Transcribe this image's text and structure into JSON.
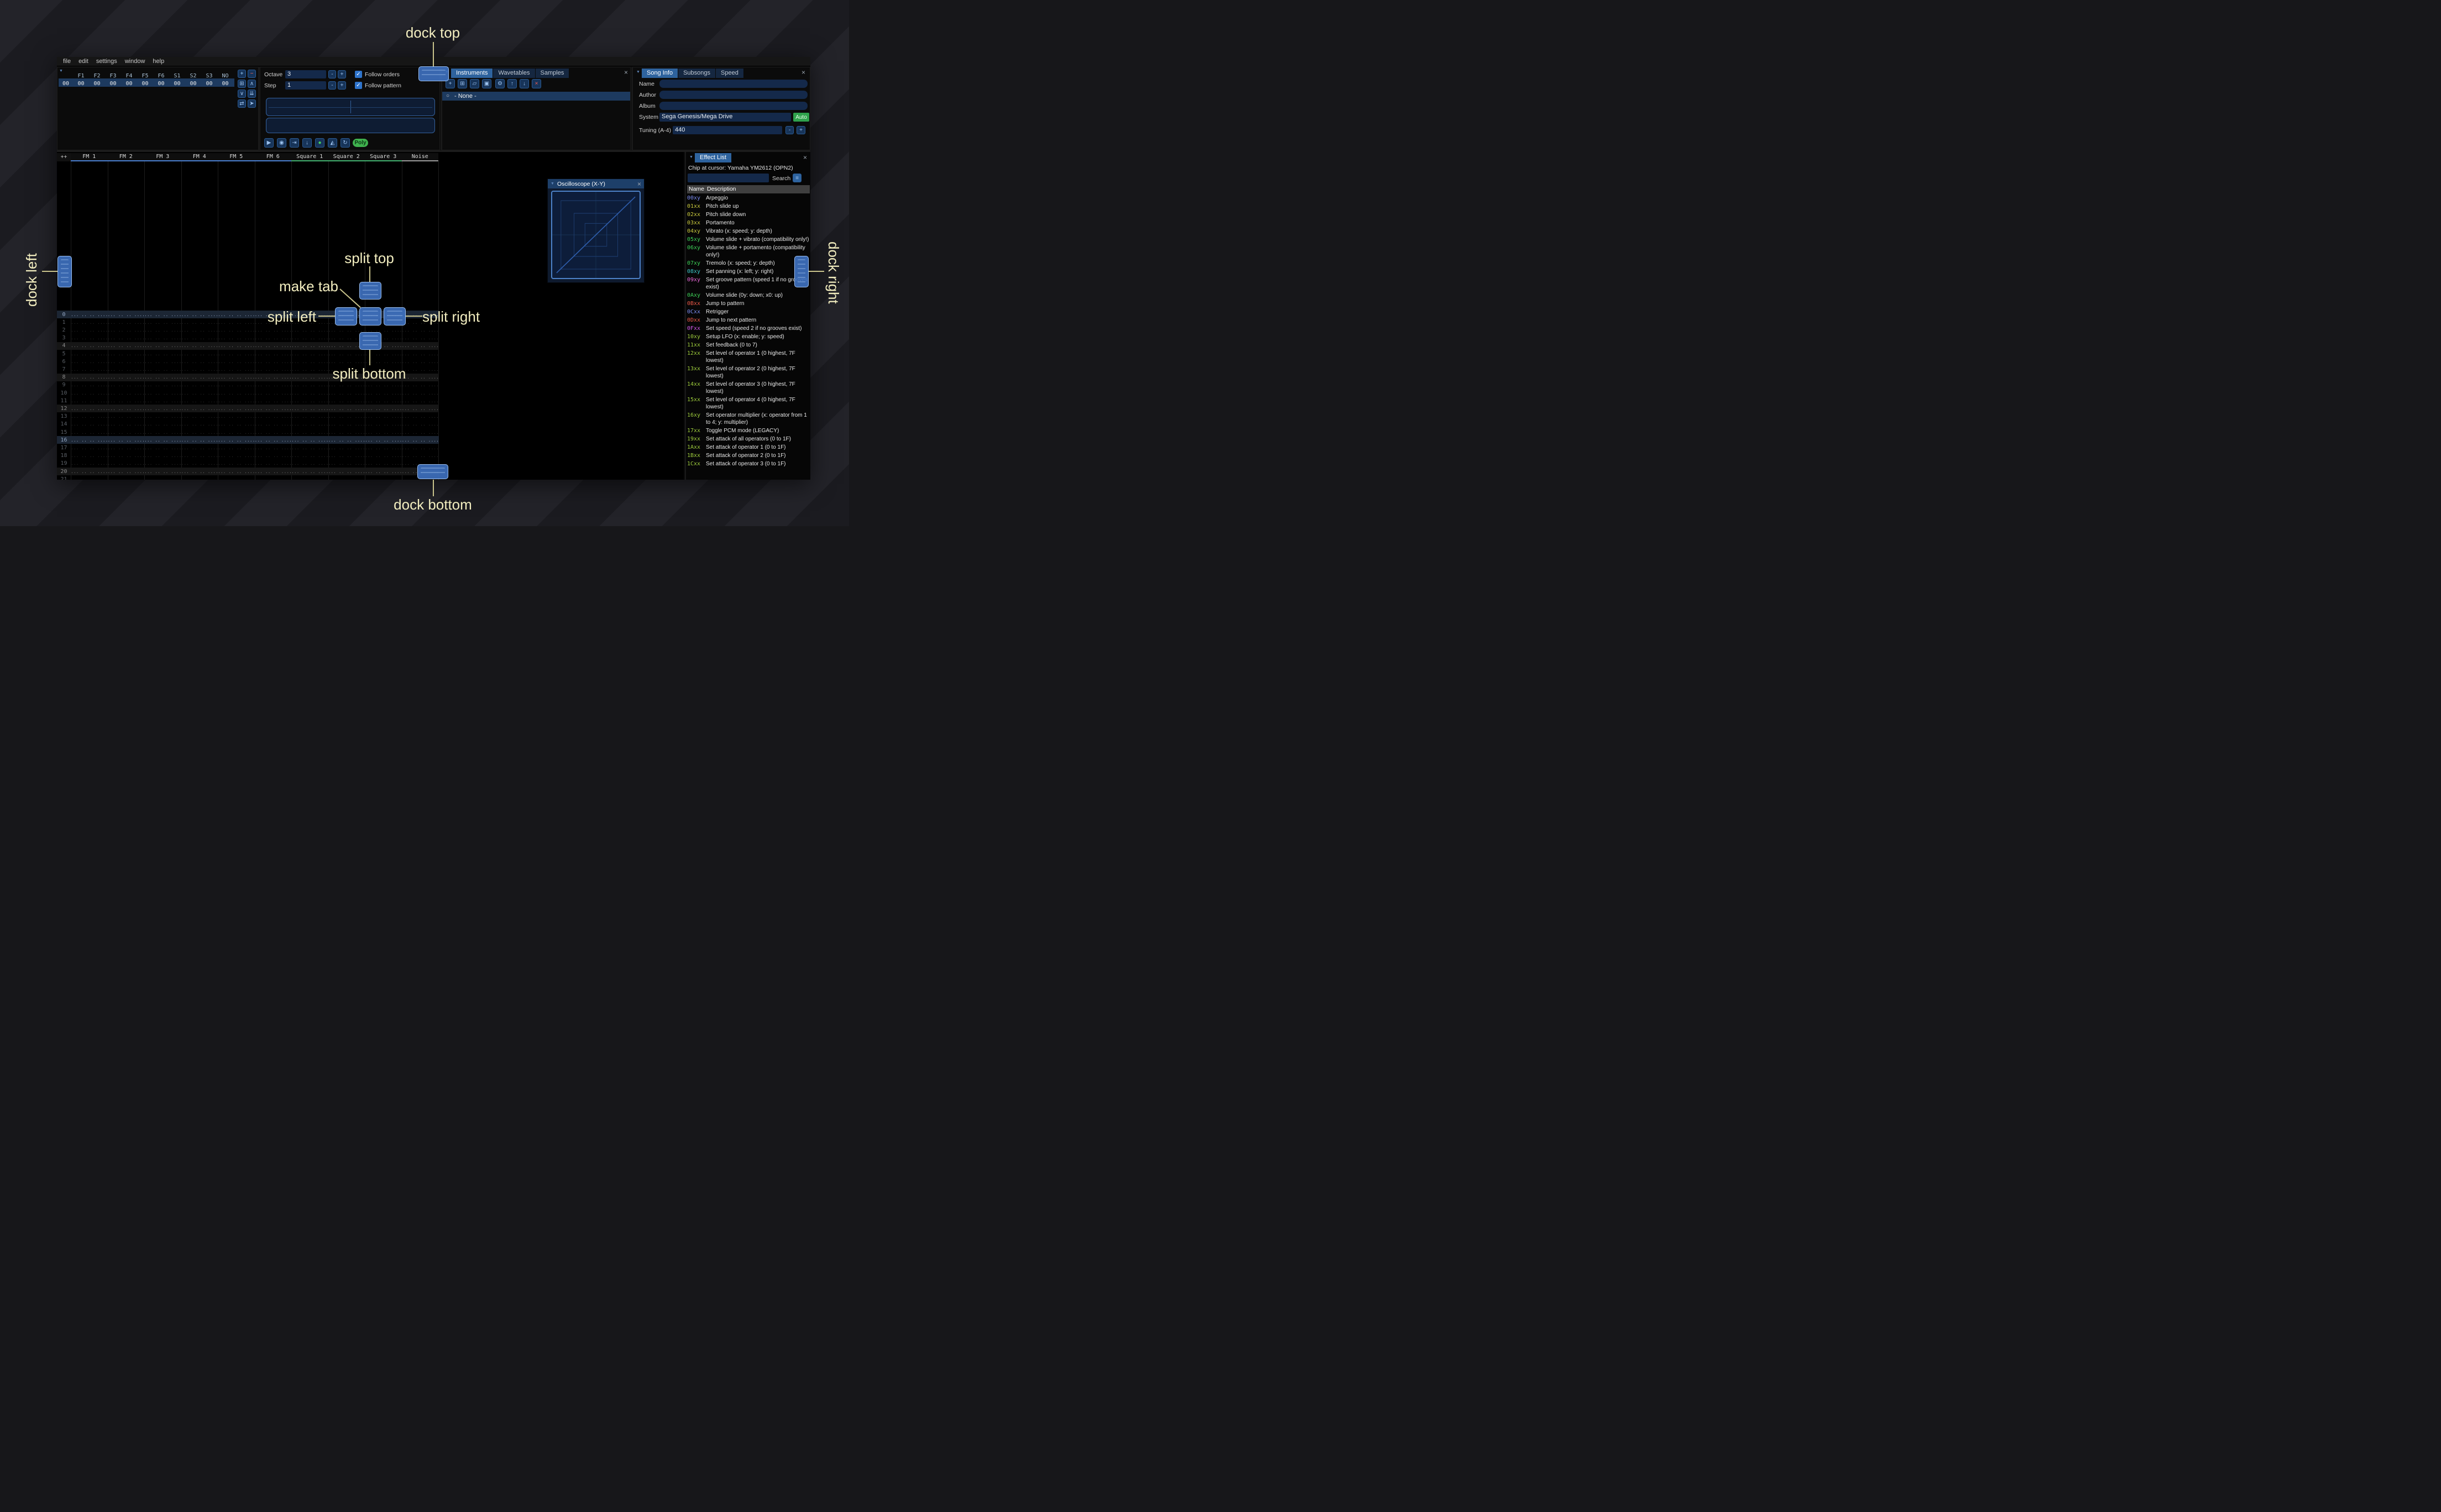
{
  "ui": {
    "collapse": "▼",
    "close": "×",
    "minus": "-",
    "plus": "+",
    "radio": "○",
    "menu_icon": "≡",
    "check": "✓"
  },
  "menu": {
    "items": [
      "file",
      "edit",
      "settings",
      "window",
      "help"
    ]
  },
  "orders": {
    "index": "00",
    "channels": [
      "F1",
      "F2",
      "F3",
      "F4",
      "F5",
      "F6",
      "S1",
      "S2",
      "S3",
      "NO"
    ],
    "values": [
      "00",
      "00",
      "00",
      "00",
      "00",
      "00",
      "00",
      "00",
      "00",
      "00"
    ],
    "buttons": [
      {
        "name": "add",
        "glyph": "+",
        "color": "#9fd4ff"
      },
      {
        "name": "remove",
        "glyph": "−",
        "color": "#ff6a57"
      },
      {
        "name": "duplicate",
        "glyph": "⊞",
        "color": "#9cc2ee"
      },
      {
        "name": "move-up",
        "glyph": "∧",
        "color": "#9cc2ee"
      },
      {
        "name": "move-down",
        "glyph": "∨",
        "color": "#9cc2ee"
      },
      {
        "name": "duplicate-to-end",
        "glyph": "⇊",
        "color": "#9cc2ee"
      },
      {
        "name": "change-all",
        "glyph": "⇄",
        "color": "#9cc2ee"
      },
      {
        "name": "order-edit-mode",
        "glyph": "➤",
        "color": "#9cc2ee"
      }
    ]
  },
  "transport": {
    "octave_label": "Octave",
    "octave_value": "3",
    "step_label": "Step",
    "step_value": "1",
    "follow_orders": "Follow orders",
    "follow_pattern": "Follow pattern",
    "poly": "Poly",
    "buttons": [
      {
        "name": "play",
        "glyph": "▶",
        "color": "#9cc2ee"
      },
      {
        "name": "play-pattern",
        "glyph": "◉",
        "color": "#9cc2ee"
      },
      {
        "name": "play-from-cursor",
        "glyph": "⇥",
        "color": "#9cc2ee"
      },
      {
        "name": "step-one-row",
        "glyph": "↓",
        "color": "#9cc2ee"
      },
      {
        "name": "edit-record",
        "glyph": "●",
        "color": "#46d15c"
      },
      {
        "name": "metronome",
        "glyph": "◭",
        "color": "#9cc2ee"
      },
      {
        "name": "repeat-pattern",
        "glyph": "↻",
        "color": "#9cc2ee"
      }
    ]
  },
  "instruments": {
    "tabs": [
      "Instruments",
      "Wavetables",
      "Samples"
    ],
    "list_item": "- None -",
    "toolbar": [
      {
        "name": "add",
        "glyph": "+",
        "color": "#9cc2ee"
      },
      {
        "name": "duplicate",
        "glyph": "⊞",
        "color": "#9cc2ee"
      },
      {
        "name": "open",
        "glyph": "▱",
        "color": "#9cc2ee"
      },
      {
        "name": "save",
        "glyph": "▣",
        "color": "#9cc2ee"
      },
      {
        "name": "toggle-folders",
        "glyph": "⚙",
        "color": "#9cc2ee"
      },
      {
        "name": "move-up",
        "glyph": "↑",
        "color": "#9cc2ee"
      },
      {
        "name": "move-down",
        "glyph": "↓",
        "color": "#9cc2ee"
      },
      {
        "name": "delete",
        "glyph": "×",
        "color": "#ff5d4f"
      }
    ]
  },
  "song_info": {
    "tabs": [
      "Song Info",
      "Subsongs",
      "Speed"
    ],
    "name_label": "Name",
    "author_label": "Author",
    "album_label": "Album",
    "system_label": "System",
    "system_value": "Sega Genesis/Mega Drive",
    "auto": "Auto",
    "tuning_label": "Tuning (A-4)",
    "tuning_value": "440"
  },
  "pattern": {
    "corner": "++",
    "empty_cell": "... .. .. ....",
    "visible_rows": 22,
    "channels": [
      {
        "name": "FM 1",
        "color": "#4a7fd0"
      },
      {
        "name": "FM 2",
        "color": "#4a7fd0"
      },
      {
        "name": "FM 3",
        "color": "#4a7fd0"
      },
      {
        "name": "FM 4",
        "color": "#4a7fd0"
      },
      {
        "name": "FM 5",
        "color": "#4a7fd0"
      },
      {
        "name": "FM 6",
        "color": "#4a7fd0"
      },
      {
        "name": "Square 1",
        "color": "#41b06e"
      },
      {
        "name": "Square 2",
        "color": "#41b06e"
      },
      {
        "name": "Square 3",
        "color": "#41b06e"
      },
      {
        "name": "Noise",
        "color": "#9a9a9a"
      }
    ]
  },
  "oscilloscope": {
    "title": "Oscilloscope (X-Y)"
  },
  "effect_list": {
    "title": "Effect List",
    "chip": "Chip at cursor: Yamaha YM2612 (OPN2)",
    "search_label": "Search",
    "columns": [
      "Name",
      "Description"
    ],
    "entries": [
      {
        "code": "00xy",
        "desc": "Arpeggio",
        "color": "#7b8cf0"
      },
      {
        "code": "01xx",
        "desc": "Pitch slide up",
        "color": "#c9c93e"
      },
      {
        "code": "02xx",
        "desc": "Pitch slide down",
        "color": "#c9c93e"
      },
      {
        "code": "03xx",
        "desc": "Portamento",
        "color": "#c9c93e"
      },
      {
        "code": "04xy",
        "desc": "Vibrato (x: speed; y: depth)",
        "color": "#c9c93e"
      },
      {
        "code": "05xy",
        "desc": "Volume slide + vibrato (compatibility only!)",
        "color": "#3ed058"
      },
      {
        "code": "06xy",
        "desc": "Volume slide + portamento (compatibility only!)",
        "color": "#3ed058"
      },
      {
        "code": "07xy",
        "desc": "Tremolo (x: speed; y: depth)",
        "color": "#3ed058"
      },
      {
        "code": "08xy",
        "desc": "Set panning (x: left; y: right)",
        "color": "#3ec8c8"
      },
      {
        "code": "09xy",
        "desc": "Set groove pattern (speed 1 if no grooves exist)",
        "color": "#e868d8"
      },
      {
        "code": "0Axy",
        "desc": "Volume slide (0y: down; x0: up)",
        "color": "#3ed058"
      },
      {
        "code": "0Bxx",
        "desc": "Jump to pattern",
        "color": "#e85848"
      },
      {
        "code": "0Cxx",
        "desc": "Retrigger",
        "color": "#7b8cf0"
      },
      {
        "code": "0Dxx",
        "desc": "Jump to next pattern",
        "color": "#e85848"
      },
      {
        "code": "0Fxx",
        "desc": "Set speed (speed 2 if no grooves exist)",
        "color": "#d058e8"
      },
      {
        "code": "10xy",
        "desc": "Setup LFO (x: enable; y: speed)",
        "color": "#9ecd3d"
      },
      {
        "code": "11xx",
        "desc": "Set feedback (0 to 7)",
        "color": "#9ecd3d"
      },
      {
        "code": "12xx",
        "desc": "Set level of operator 1 (0 highest, 7F lowest)",
        "color": "#9ecd3d"
      },
      {
        "code": "13xx",
        "desc": "Set level of operator 2 (0 highest, 7F lowest)",
        "color": "#9ecd3d"
      },
      {
        "code": "14xx",
        "desc": "Set level of operator 3 (0 highest, 7F lowest)",
        "color": "#9ecd3d"
      },
      {
        "code": "15xx",
        "desc": "Set level of operator 4 (0 highest, 7F lowest)",
        "color": "#9ecd3d"
      },
      {
        "code": "16xy",
        "desc": "Set operator multiplier (x: operator from 1 to 4; y: multiplier)",
        "color": "#9ecd3d"
      },
      {
        "code": "17xx",
        "desc": "Toggle PCM mode (LEGACY)",
        "color": "#9ecd3d"
      },
      {
        "code": "19xx",
        "desc": "Set attack of all operators (0 to 1F)",
        "color": "#9ecd3d"
      },
      {
        "code": "1Axx",
        "desc": "Set attack of operator 1 (0 to 1F)",
        "color": "#9ecd3d"
      },
      {
        "code": "1Bxx",
        "desc": "Set attack of operator 2 (0 to 1F)",
        "color": "#9ecd3d"
      },
      {
        "code": "1Cxx",
        "desc": "Set attack of operator 3 (0 to 1F)",
        "color": "#9ecd3d"
      }
    ]
  },
  "overlay": {
    "accent_text": "#f3eec0",
    "line_color": "#cbc58d",
    "target_fill": "#3e70be",
    "labels": {
      "dock_top": "dock top",
      "dock_bottom": "dock bottom",
      "dock_left": "dock left",
      "dock_right": "dock right",
      "split_top": "split top",
      "split_bottom": "split bottom",
      "split_left": "split left",
      "split_right": "split right",
      "make_tab": "make tab"
    }
  }
}
